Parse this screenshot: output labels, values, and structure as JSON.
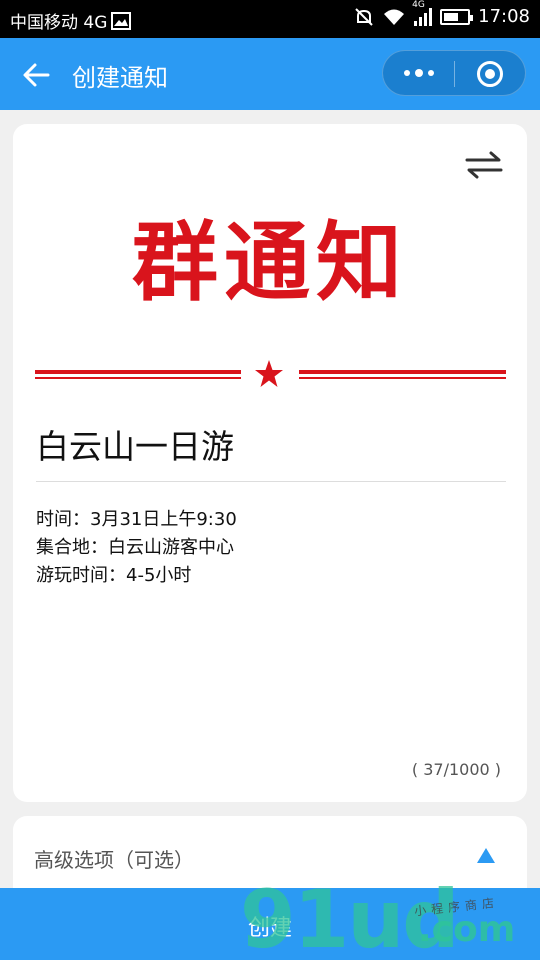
{
  "status_bar": {
    "carrier": "中国移动 4G",
    "network_badge": "4G",
    "time": "17:08",
    "icons": [
      "gallery-icon",
      "mute-icon",
      "wifi-icon",
      "signal-icon",
      "battery-icon"
    ]
  },
  "nav": {
    "title": "创建通知",
    "back_icon": "arrow-left-icon",
    "more_icon": "more-dots-icon",
    "close_icon": "target-close-icon"
  },
  "notice": {
    "banner": "群通知",
    "banner_color": "#d9141c",
    "title": "白云山一日游",
    "lines": [
      "时间：3月31日上午9:30",
      "集合地：白云山游客中心",
      "游玩时间：4-5小时"
    ],
    "char_count": "( 37/1000 )",
    "swap_icon": "swap-arrows-icon"
  },
  "advanced": {
    "label": "高级选项（可选）",
    "toggle_icon": "triangle-up-icon"
  },
  "footer": {
    "create_label": "创建"
  },
  "watermark": {
    "main": "91ud",
    "suffix": ".com",
    "tagline": "小程序商店"
  },
  "colors": {
    "primary": "#2b9af3",
    "accent_red": "#d9141c",
    "watermark": "#2fc49a"
  }
}
